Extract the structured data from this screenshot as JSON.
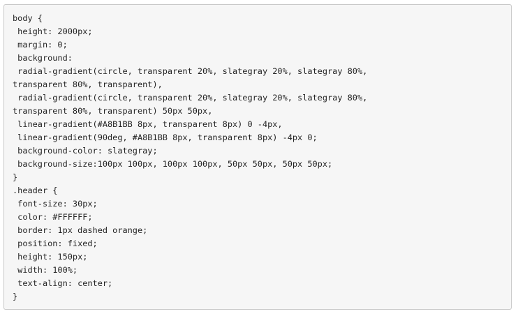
{
  "code": {
    "lines": [
      "body {",
      " height: 2000px;",
      " margin: 0;",
      " background:",
      " radial-gradient(circle, transparent 20%, slategray 20%, slategray 80%,",
      "transparent 80%, transparent),",
      " radial-gradient(circle, transparent 20%, slategray 20%, slategray 80%,",
      "transparent 80%, transparent) 50px 50px,",
      " linear-gradient(#A8B1BB 8px, transparent 8px) 0 -4px,",
      " linear-gradient(90deg, #A8B1BB 8px, transparent 8px) -4px 0;",
      " background-color: slategray;",
      " background-size:100px 100px, 100px 100px, 50px 50px, 50px 50px;",
      "}",
      ".header {",
      " font-size: 30px;",
      " color: #FFFFFF;",
      " border: 1px dashed orange;",
      " position: fixed;",
      " height: 150px;",
      " width: 100%;",
      " text-align: center;",
      "}"
    ]
  }
}
